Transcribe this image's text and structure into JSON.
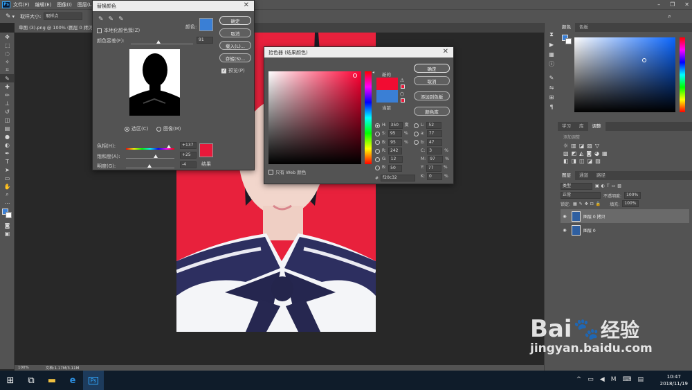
{
  "app": {
    "ps_logo": "Ps",
    "menu": [
      "文件(F)",
      "编辑(E)",
      "图像(I)",
      "图层(L)"
    ]
  },
  "options": {
    "size_label": "取样大小:",
    "size_value": "取样点"
  },
  "document": {
    "tab": "草图 (3).png @ 100% (图层 0 拷贝, R",
    "zoom": "100%",
    "doc_info": "文档:1.17M/3.11M"
  },
  "replace_color": {
    "title": "替换颜色",
    "localized_label": "本地化颜色簇(Z)",
    "color_label": "颜色:",
    "color_swatch": "#3a7fd5",
    "fuzziness_label": "颜色容差(F):",
    "fuzziness_value": "91",
    "selection_label": "选区(C)",
    "image_label": "图像(M)",
    "hue_label": "色相(H):",
    "hue_value": "+137",
    "saturation_label": "饱和度(A):",
    "saturation_value": "+25",
    "lightness_label": "明度(G):",
    "lightness_value": "-4",
    "result_label": "结果",
    "result_swatch": "#e8183a",
    "buttons": {
      "ok": "确定",
      "cancel": "取消",
      "load": "载入(L)...",
      "save": "存储(S)..."
    },
    "preview_label": "预览(P)"
  },
  "color_picker": {
    "title": "拾色器 (结果颜色)",
    "new_label": "新的",
    "current_label": "当前",
    "new_swatch": "#f20c32",
    "current_swatch": "#3a7fd5",
    "buttons": {
      "ok": "确定",
      "cancel": "取消",
      "add": "添加到色板",
      "library": "颜色库"
    },
    "web_only": "只有 Web 颜色",
    "fields": {
      "H": "350",
      "H_unit": "度",
      "S": "95",
      "S_unit": "%",
      "B": "95",
      "B_unit": "%",
      "R": "242",
      "G": "12",
      "Bv": "50",
      "L": "52",
      "a": "77",
      "b": "47",
      "C": "3",
      "M": "97",
      "Y": "77",
      "K": "0"
    },
    "hex": "f20c32"
  },
  "panels": {
    "color_tabs": [
      "颜色",
      "色板"
    ],
    "adjust_tabs": [
      "学习",
      "库",
      "调整"
    ],
    "adjust_hint": "添加调整",
    "layer_tabs": [
      "图层",
      "通道",
      "路径"
    ],
    "kind_label": "类型",
    "blend_mode": "正常",
    "opacity_label": "不透明度:",
    "opacity_value": "100%",
    "lock_label": "锁定:",
    "fill_label": "填充:",
    "fill_value": "100%",
    "layers": [
      "图层 0 拷贝",
      "图层 0"
    ]
  },
  "taskbar": {
    "time": "10:47",
    "date": "2018/11/19"
  },
  "watermark": {
    "brand": "Bai",
    "brand2": "经验",
    "url": "jingyan.baidu.com"
  }
}
